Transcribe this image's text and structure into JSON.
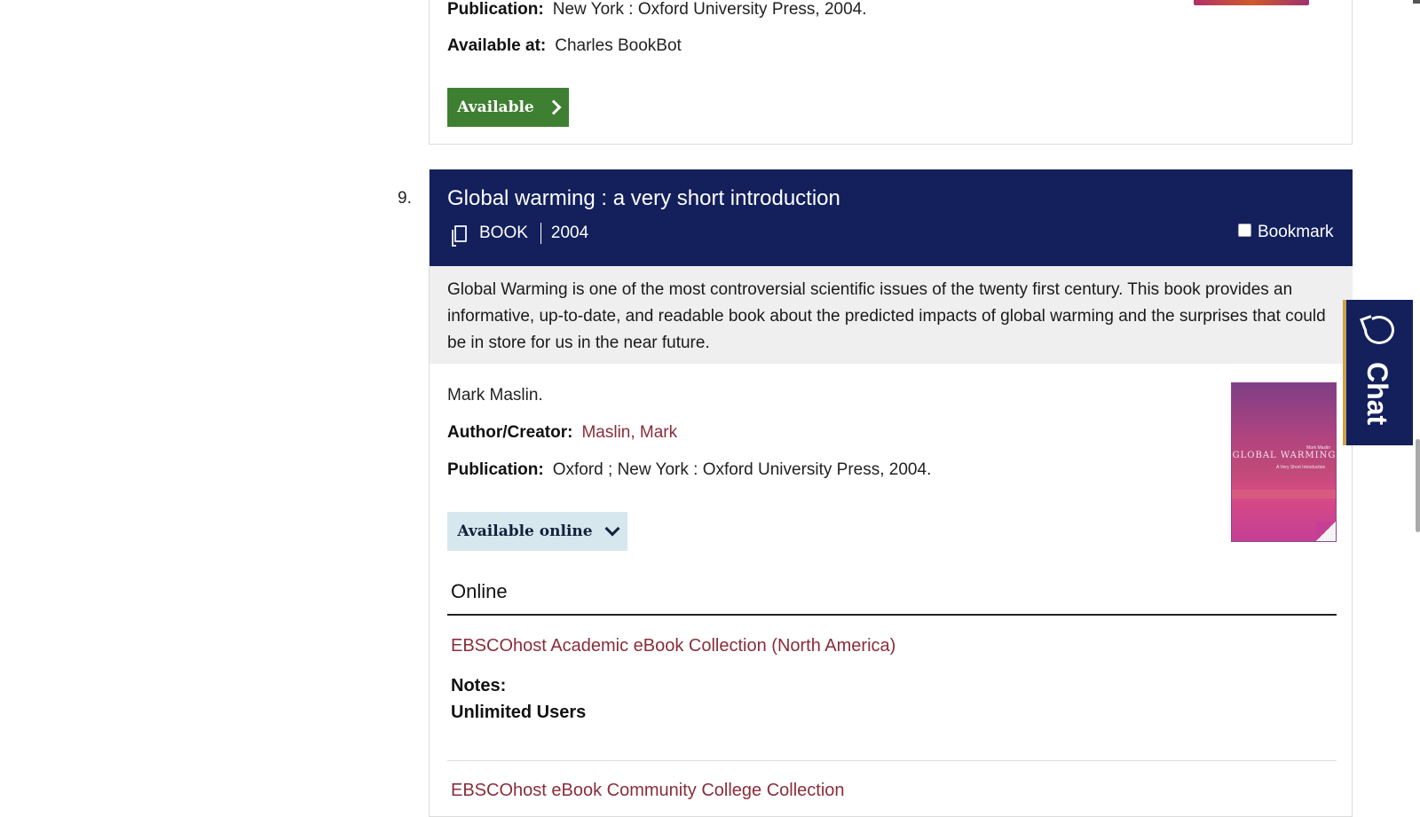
{
  "previous_record": {
    "publication_label": "Publication:",
    "publication_value": "New York : Oxford University Press, 2004.",
    "available_at_label": "Available at:",
    "available_at_value": "Charles BookBot",
    "available_button": "Available"
  },
  "record": {
    "number": "9.",
    "title": "Global warming : a very short introduction",
    "type": "BOOK",
    "year": "2004",
    "bookmark_label": "Bookmark",
    "abstract": "Global Warming is one of the most controversial scientific issues of the twenty first century. This book provides an informative, up-to-date, and readable book about the predicted impacts of global warming and the surprises that could be in store for us in the near future.",
    "statement": "Mark Maslin.",
    "author_label": "Author/Creator:",
    "author_value": "Maslin, Mark",
    "publication_label": "Publication:",
    "publication_value": "Oxford ; New York : Oxford University Press, 2004.",
    "available_online_button": "Available online",
    "cover": {
      "title": "GLOBAL WARMING",
      "subtitle": "A Very Short Introduction",
      "author": "Mark Maslin"
    },
    "online_heading": "Online",
    "links": [
      "EBSCOhost Academic eBook Collection (North America)",
      "EBSCOhost eBook Community College Collection"
    ],
    "notes_label": "Notes:",
    "notes_value": "Unlimited Users"
  },
  "chat": {
    "label": "Chat"
  },
  "colors": {
    "header_bg": "#13205c",
    "available_green": "#3f7f32",
    "link": "#8a2d3a",
    "online_button_bg": "#d6e7ee",
    "abstract_bg": "#efefef"
  }
}
